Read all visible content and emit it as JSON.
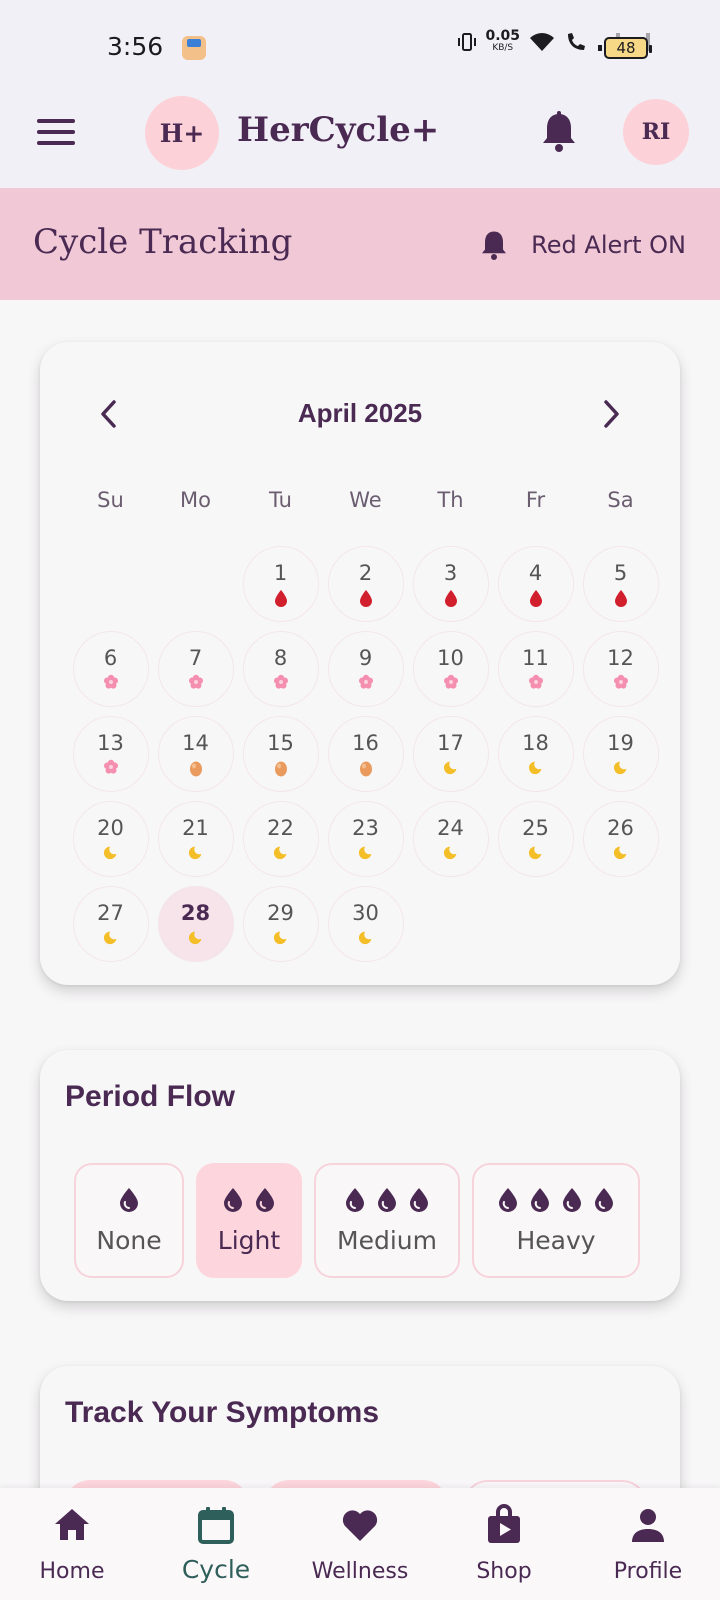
{
  "status_bar": {
    "time": "3:56",
    "net_speed": "0.05",
    "net_unit": "KB/S",
    "battery": "48"
  },
  "app_bar": {
    "logo": "H+",
    "title": "HerCycle+",
    "avatar": "RI"
  },
  "header": {
    "title": "Cycle Tracking",
    "alert": "Red Alert ON"
  },
  "calendar": {
    "month": "April 2025",
    "weekdays": [
      "Su",
      "Mo",
      "Tu",
      "We",
      "Th",
      "Fr",
      "Sa"
    ],
    "days": [
      {
        "n": "",
        "m": ""
      },
      {
        "n": "",
        "m": ""
      },
      {
        "n": "1",
        "m": "blood-drop"
      },
      {
        "n": "2",
        "m": "blood-drop"
      },
      {
        "n": "3",
        "m": "blood-drop"
      },
      {
        "n": "4",
        "m": "blood-drop"
      },
      {
        "n": "5",
        "m": "blood-drop"
      },
      {
        "n": "6",
        "m": "flower"
      },
      {
        "n": "7",
        "m": "flower"
      },
      {
        "n": "8",
        "m": "flower"
      },
      {
        "n": "9",
        "m": "flower"
      },
      {
        "n": "10",
        "m": "flower"
      },
      {
        "n": "11",
        "m": "flower"
      },
      {
        "n": "12",
        "m": "flower"
      },
      {
        "n": "13",
        "m": "flower"
      },
      {
        "n": "14",
        "m": "egg"
      },
      {
        "n": "15",
        "m": "egg"
      },
      {
        "n": "16",
        "m": "egg"
      },
      {
        "n": "17",
        "m": "moon"
      },
      {
        "n": "18",
        "m": "moon"
      },
      {
        "n": "19",
        "m": "moon"
      },
      {
        "n": "20",
        "m": "moon"
      },
      {
        "n": "21",
        "m": "moon"
      },
      {
        "n": "22",
        "m": "moon"
      },
      {
        "n": "23",
        "m": "moon"
      },
      {
        "n": "24",
        "m": "moon"
      },
      {
        "n": "25",
        "m": "moon"
      },
      {
        "n": "26",
        "m": "moon"
      },
      {
        "n": "27",
        "m": "moon"
      },
      {
        "n": "28",
        "m": "moon",
        "today": true
      },
      {
        "n": "29",
        "m": "moon"
      },
      {
        "n": "30",
        "m": "moon"
      }
    ]
  },
  "flow": {
    "title": "Period Flow",
    "options": [
      {
        "label": "None",
        "drops": 1,
        "selected": false
      },
      {
        "label": "Light",
        "drops": 2,
        "selected": true
      },
      {
        "label": "Medium",
        "drops": 3,
        "selected": false
      },
      {
        "label": "Heavy",
        "drops": 4,
        "selected": false
      }
    ]
  },
  "symptoms": {
    "title": "Track Your Symptoms"
  },
  "nav": {
    "items": [
      {
        "label": "Home",
        "icon": "home-icon",
        "active": false
      },
      {
        "label": "Cycle",
        "icon": "calendar-icon",
        "active": true
      },
      {
        "label": "Wellness",
        "icon": "heart-icon",
        "active": false
      },
      {
        "label": "Shop",
        "icon": "shop-bag-icon",
        "active": false
      },
      {
        "label": "Profile",
        "icon": "person-icon",
        "active": false
      }
    ]
  },
  "colors": {
    "primary": "#4a2a52",
    "pink": "#fdd5dd",
    "band": "#f0c8d6",
    "active_nav": "#2f5f5a"
  }
}
